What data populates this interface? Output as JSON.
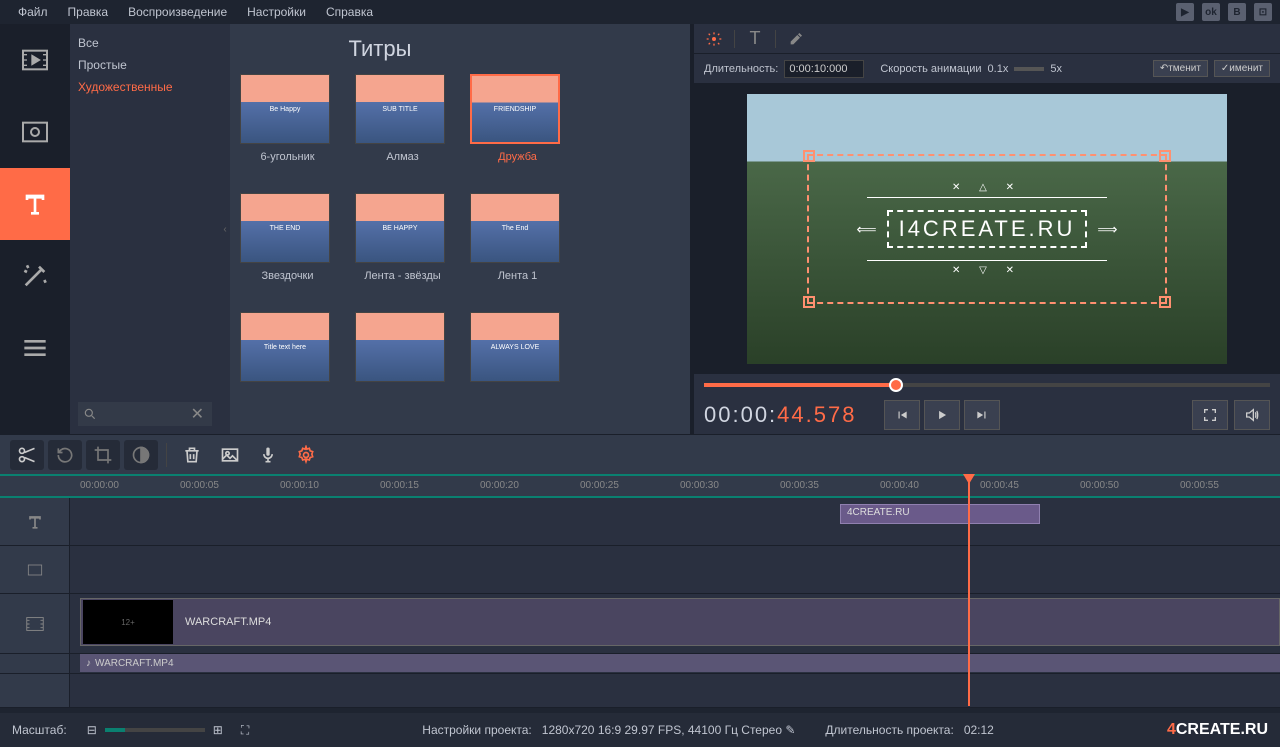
{
  "menu": {
    "items": [
      "Файл",
      "Правка",
      "Воспроизведение",
      "Настройки",
      "Справка"
    ]
  },
  "sidebar": {
    "active_index": 2
  },
  "panel": {
    "title": "Титры",
    "categories": [
      "Все",
      "Простые",
      "Художественные"
    ],
    "active_category": 2
  },
  "titles": {
    "row1": [
      {
        "label": "6-угольник",
        "txt": "Be Happy"
      },
      {
        "label": "Алмаз",
        "txt": "SUB TITLE"
      },
      {
        "label": "Дружба",
        "txt": "FRIENDSHIP",
        "selected": true
      }
    ],
    "row2": [
      {
        "label": "Звездочки",
        "txt": "THE END"
      },
      {
        "label": "Лента - звёзды",
        "txt": "BE HAPPY"
      },
      {
        "label": "Лента 1",
        "txt": "The End"
      }
    ],
    "row3": [
      {
        "label": "",
        "txt": "Title text here"
      },
      {
        "label": "",
        "txt": ""
      },
      {
        "label": "",
        "txt": "ALWAYS LOVE"
      }
    ]
  },
  "preview": {
    "duration_label": "Длительность:",
    "duration_value": "0:00:10:000",
    "speed_label": "Скорость анимации",
    "speed_min": "0.1x",
    "speed_max": "5x",
    "undo": "↶тменит",
    "apply": "✓именит",
    "overlay_text": "I4CREATE.RU",
    "overlay_sym_top": "✕  △  ✕",
    "overlay_sym_bot": "✕  ▽  ✕",
    "timecode_white": "00:00:",
    "timecode_orange": "44.578"
  },
  "timeline": {
    "ticks": [
      "00:00:00",
      "00:00:05",
      "00:00:10",
      "00:00:15",
      "00:00:20",
      "00:00:25",
      "00:00:30",
      "00:00:35",
      "00:00:40",
      "00:00:45",
      "00:00:50",
      "00:00:55"
    ],
    "title_clip": "4CREATE.RU",
    "video_clip": "WARCRAFT.MP4",
    "video_thumb": "12+",
    "audio_clip": "WARCRAFT.MP4"
  },
  "status": {
    "zoom_label": "Масштаб:",
    "project_label": "Настройки проекта:",
    "project_value": "1280x720 16:9 29.97 FPS, 44100 Гц Стерео",
    "duration_label": "Длительность проекта:",
    "duration_value": "02:12",
    "logo_4": "4",
    "logo_rest": "CREATE.RU"
  }
}
